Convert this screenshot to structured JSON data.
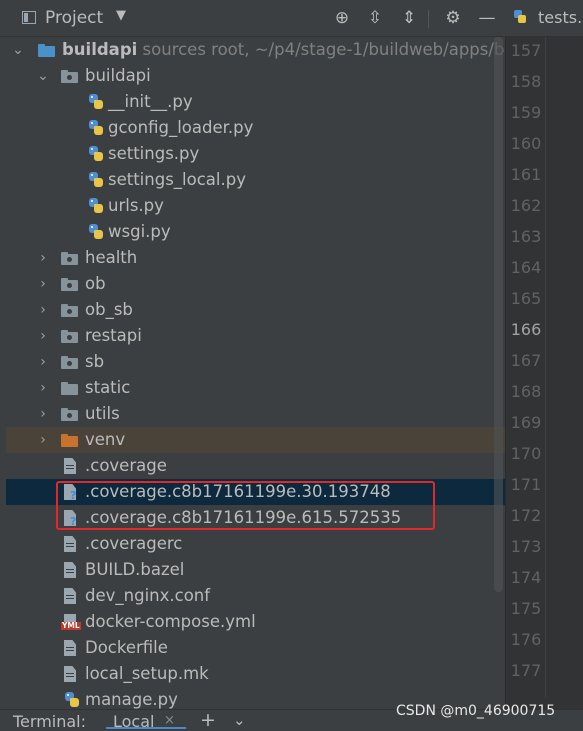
{
  "header": {
    "title": "Project",
    "dropdown_icon": "chevron-down-icon",
    "buttons": [
      "target-icon",
      "expand-all-icon",
      "collapse-all-icon",
      "gear-icon",
      "minimize-icon"
    ]
  },
  "editor_tab": {
    "label": "tests."
  },
  "tree": {
    "root": {
      "name": "buildapi",
      "detail": "sources root,  ~/p4/stage-1/buildweb/apps/b"
    },
    "package": {
      "name": "buildapi",
      "files": [
        "__init__.py",
        "gconfig_loader.py",
        "settings.py",
        "settings_local.py",
        "urls.py",
        "wsgi.py"
      ]
    },
    "folders": [
      "health",
      "ob",
      "ob_sb",
      "restapi",
      "sb",
      "static",
      "utils",
      "venv"
    ],
    "files": [
      ".coverage",
      ".coverage.c8b17161199e.30.193748",
      ".coverage.c8b17161199e.615.572535",
      ".coveragerc",
      "BUILD.bazel",
      "dev_nginx.conf",
      "docker-compose.yml",
      "Dockerfile",
      "local_setup.mk",
      "manage.py"
    ]
  },
  "line_numbers": [
    "157",
    "158",
    "159",
    "160",
    "161",
    "162",
    "163",
    "164",
    "165",
    "166",
    "167",
    "168",
    "169",
    "170",
    "171",
    "172",
    "173",
    "174",
    "175",
    "176",
    "177"
  ],
  "current_line": "166",
  "terminal": {
    "label": "Terminal:",
    "tab": "Local",
    "close": "×",
    "add": "+",
    "more": "⌄"
  },
  "watermark": "CSDN @m0_46900715",
  "colors": {
    "background": "#3c3f41",
    "selection": "#0d293e",
    "highlight_box": "#e3282a",
    "venv_row": "#49433a"
  }
}
